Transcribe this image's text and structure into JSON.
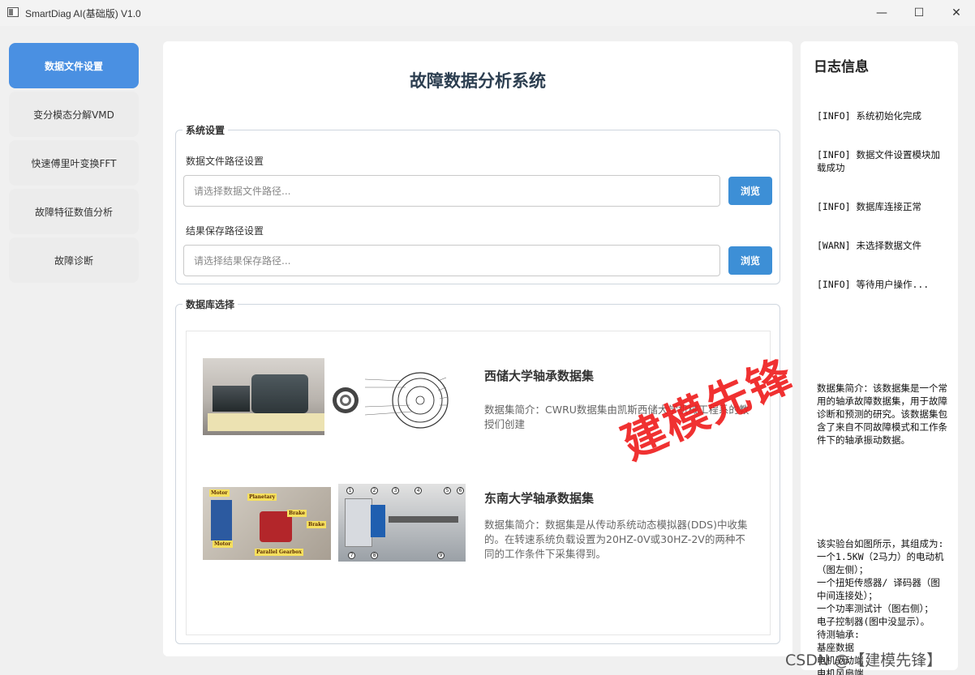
{
  "window": {
    "title": "SmartDiag AI(基础版) V1.0",
    "minimize": "—",
    "maximize": "☐",
    "close": "✕"
  },
  "nav": {
    "items": [
      {
        "label": "数据文件设置",
        "active": true
      },
      {
        "label": "变分模态分解VMD",
        "active": false
      },
      {
        "label": "快速傅里叶变换FFT",
        "active": false
      },
      {
        "label": "故障特征数值分析",
        "active": false
      },
      {
        "label": "故障诊断",
        "active": false
      }
    ]
  },
  "main": {
    "title": "故障数据分析系统",
    "system_settings": {
      "legend": "系统设置",
      "data_path_label": "数据文件路径设置",
      "data_path_placeholder": "请选择数据文件路径...",
      "data_browse": "浏览",
      "result_path_label": "结果保存路径设置",
      "result_path_placeholder": "请选择结果保存路径...",
      "result_browse": "浏览"
    },
    "database": {
      "legend": "数据库选择",
      "items": [
        {
          "name": "西储大学轴承数据集",
          "desc": "数据集简介：CWRU数据集由凯斯西储大学机械工程系的教授们创建"
        },
        {
          "name": "东南大学轴承数据集",
          "desc": "数据集简介：数据集是从传动系统动态模拟器(DDS)中收集的。在转速系统负载设置为20HZ-0V或30HZ-2V的两种不同的工作条件下采集得到。"
        }
      ]
    }
  },
  "log": {
    "title": "日志信息",
    "lines": [
      "[INFO] 系统初始化完成",
      "[INFO] 数据文件设置模块加载成功",
      "[INFO] 数据库连接正常",
      "[WARN] 未选择数据文件",
      "[INFO] 等待用户操作..."
    ],
    "dataset_intro": "数据集简介：该数据集是一个常用的轴承故障数据集，用于故障诊断和预测的研究。该数据集包含了来自不同故障模式和工作条件下的轴承振动数据。",
    "rig_intro": "该实验台如图所示，其组成为:\n一个1.5KW（2马力）的电动机（图左侧）；\n一个扭矩传感器/ 译码器（图中间连接处）；\n一个功率测试计（图右侧）；\n电子控制器(图中没显示）。\n待测轴承:\n基座数据\n电机驱动端\n电机风扇端"
  },
  "overlay": {
    "watermark": "建模先锋",
    "credit": "CSDN @【建模先锋】"
  }
}
